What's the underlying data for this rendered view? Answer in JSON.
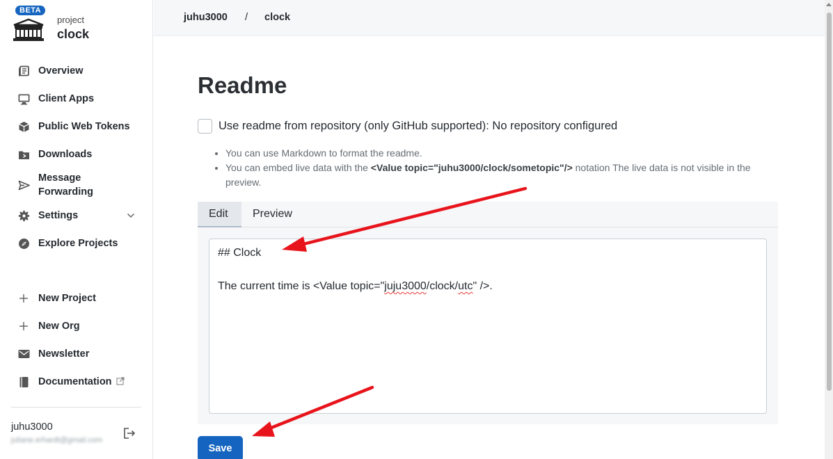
{
  "brand": {
    "badge": "BETA",
    "kicker": "project",
    "title": "clock"
  },
  "sidebar": {
    "items": [
      {
        "label": "Overview",
        "icon": "book-icon"
      },
      {
        "label": "Client Apps",
        "icon": "monitor-icon"
      },
      {
        "label": "Public Web Tokens",
        "icon": "cube-icon"
      },
      {
        "label": "Downloads",
        "icon": "folder-icon"
      },
      {
        "label": "Message Forwarding",
        "icon": "send-icon"
      },
      {
        "label": "Settings",
        "icon": "gear-icon"
      },
      {
        "label": "Explore Projects",
        "icon": "compass-icon"
      }
    ],
    "secondary": [
      {
        "label": "New Project",
        "icon": "plus-icon"
      },
      {
        "label": "New Org",
        "icon": "plus-icon"
      },
      {
        "label": "Newsletter",
        "icon": "mail-icon"
      },
      {
        "label": "Documentation",
        "icon": "book-closed-icon"
      }
    ]
  },
  "user": {
    "name": "juhu3000",
    "email": "juliane.erhardt@gmail.com"
  },
  "breadcrumb": {
    "org": "juhu3000",
    "separator": "/",
    "project": "clock"
  },
  "main": {
    "title": "Readme",
    "repo_checkbox_label": "Use readme from repository (only GitHub supported): No repository configured",
    "hint1": "You can use Markdown to format the readme.",
    "hint2_pre": "You can embed live data with the ",
    "hint2_code": "<Value topic=\"juhu3000/clock/sometopic\"/>",
    "hint2_post": " notation The live data is not visible in the preview.",
    "tabs": [
      "Edit",
      "Preview"
    ],
    "editor": {
      "line1": "## Clock",
      "line3_pre": "The current time is <Value topic=\"",
      "line3_word1": "juju3000",
      "line3_mid": "/clock/",
      "line3_word2": "utc",
      "line3_post": "\" />."
    },
    "save_label": "Save"
  },
  "colors": {
    "accent": "#1565c0",
    "annotation": "#e8141c"
  }
}
